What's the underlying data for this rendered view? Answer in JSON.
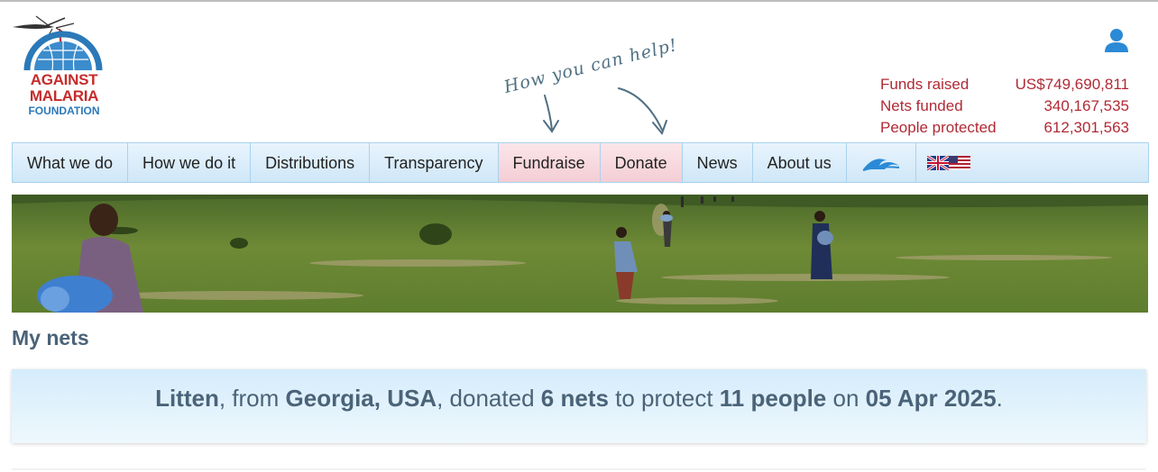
{
  "logo": {
    "line1": "AGAINST",
    "line2": "MALARIA",
    "line3": "FOUNDATION"
  },
  "help_text": "How you can help!",
  "stats": [
    {
      "label": "Funds raised",
      "value": "US$749,690,811"
    },
    {
      "label": "Nets funded",
      "value": "340,167,535"
    },
    {
      "label": "People protected",
      "value": "612,301,563"
    }
  ],
  "nav": {
    "items": [
      {
        "label": "What we do"
      },
      {
        "label": "How we do it"
      },
      {
        "label": "Distributions"
      },
      {
        "label": "Transparency"
      },
      {
        "label": "Fundraise"
      },
      {
        "label": "Donate"
      },
      {
        "label": "News"
      },
      {
        "label": "About us"
      }
    ]
  },
  "page_heading": "My nets",
  "message": {
    "donor": "Litten",
    "from_text": ", from ",
    "location": "Georgia, USA",
    "donated_text": ", donated ",
    "nets": "6 nets",
    "protect_text": " to protect ",
    "people": "11 people",
    "on_text": " on ",
    "date": "05 Apr 2025",
    "end_text": "."
  },
  "colors": {
    "accent_red": "#b02a35",
    "nav_bg": "#d9edfa",
    "highlight_pink": "#f4cdd5",
    "text_slate": "#4a6378"
  }
}
